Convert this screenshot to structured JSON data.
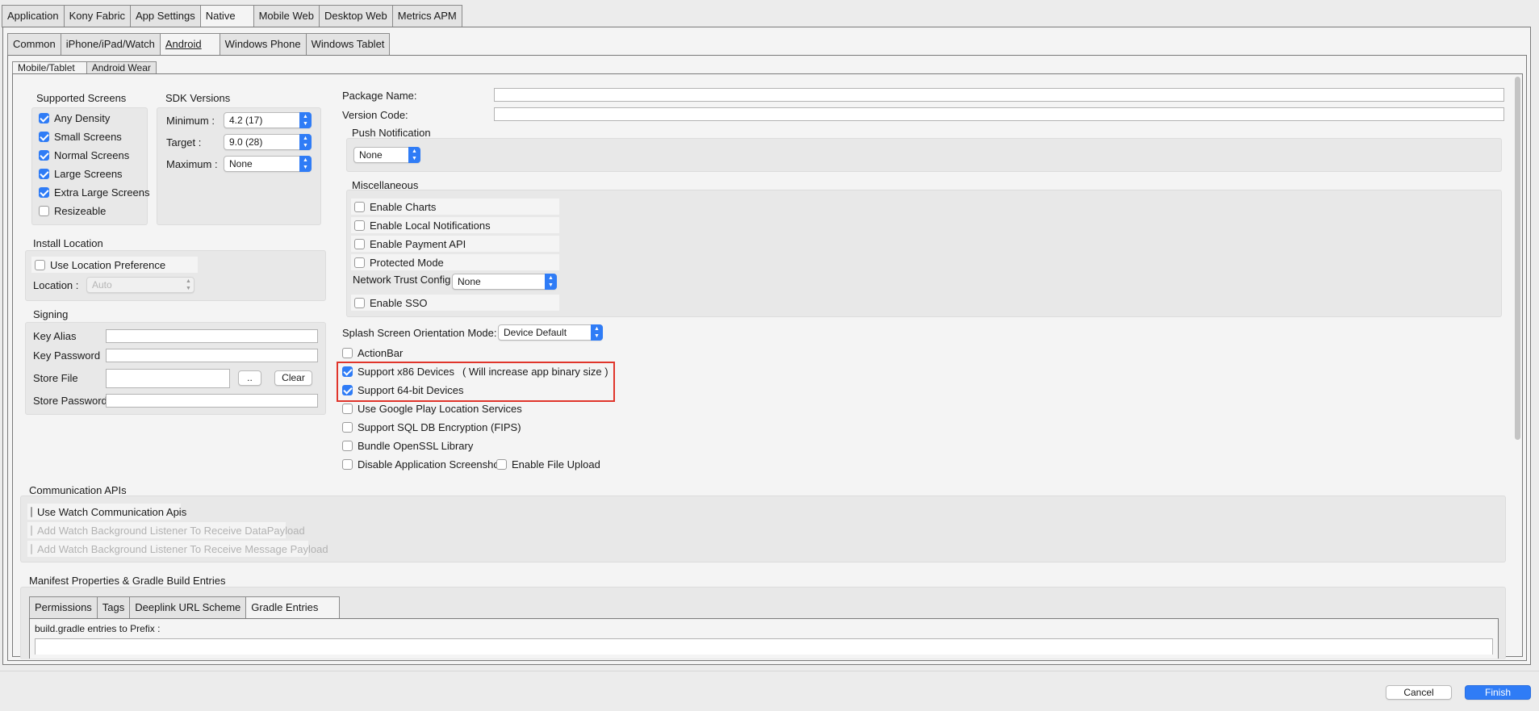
{
  "top_tabs": [
    "Application",
    "Kony Fabric",
    "App Settings",
    "Native",
    "Mobile Web",
    "Desktop Web",
    "Metrics APM"
  ],
  "platform_tabs": [
    "Common",
    "iPhone/iPad/Watch",
    "Android",
    "Windows Phone",
    "Windows Tablet"
  ],
  "device_tabs": [
    "Mobile/Tablet",
    "Android Wear"
  ],
  "supported_screens": {
    "title": "Supported Screens",
    "items": [
      {
        "label": "Any Density",
        "checked": true
      },
      {
        "label": "Small Screens",
        "checked": true
      },
      {
        "label": "Normal Screens",
        "checked": true
      },
      {
        "label": "Large Screens",
        "checked": true
      },
      {
        "label": "Extra Large Screens",
        "checked": true
      },
      {
        "label": "Resizeable",
        "checked": false
      }
    ]
  },
  "sdk": {
    "title": "SDK Versions",
    "minimum_label": "Minimum :",
    "minimum_value": "4.2 (17)",
    "target_label": "Target :",
    "target_value": "9.0 (28)",
    "maximum_label": "Maximum :",
    "maximum_value": "None"
  },
  "install_location": {
    "title": "Install Location",
    "use_pref_label": "Use Location Preference",
    "location_label": "Location :",
    "location_value": "Auto"
  },
  "signing": {
    "title": "Signing",
    "key_alias": "Key Alias",
    "key_password": "Key Password",
    "store_file": "Store File",
    "browse_label": "..",
    "clear_label": "Clear",
    "store_password": "Store Password"
  },
  "package": {
    "name_label": "Package Name:",
    "version_label": "Version Code:"
  },
  "push": {
    "title": "Push Notification",
    "value": "None"
  },
  "misc": {
    "title": "Miscellaneous",
    "enable_charts": "Enable Charts",
    "enable_local_notifications": "Enable Local Notifications",
    "enable_payment_api": "Enable Payment API",
    "protected_mode": "Protected Mode",
    "network_trust_label": "Network Trust Config",
    "network_trust_value": "None",
    "enable_sso": "Enable SSO"
  },
  "splash": {
    "label": "Splash Screen Orientation Mode:",
    "value": "Device Default"
  },
  "options": {
    "action_bar": "ActionBar",
    "x86": "Support x86 Devices",
    "x86_note": "( Will increase app binary size )",
    "bit64": "Support 64-bit Devices",
    "google_play": "Use Google Play Location Services",
    "sql_encryption": "Support SQL DB Encryption (FIPS)",
    "openssl": "Bundle OpenSSL Library",
    "disable_screenshot": "Disable Application Screenshot",
    "file_upload": "Enable File Upload"
  },
  "highlight_color": "#e0352b",
  "accent_color": "#2f7cf6",
  "comm": {
    "title": "Communication APIs",
    "use_watch": "Use Watch Communication Apis",
    "data_payload": "Add Watch Background Listener To Receive DataPayload",
    "message_payload": "Add Watch Background Listener To Receive Message Payload"
  },
  "manifest": {
    "title": "Manifest Properties & Gradle Build Entries",
    "tabs": [
      "Permissions",
      "Tags",
      "Deeplink URL Scheme",
      "Gradle Entries"
    ],
    "prefix_label": "build.gradle entries to Prefix :"
  },
  "footer": {
    "cancel": "Cancel",
    "finish": "Finish"
  }
}
